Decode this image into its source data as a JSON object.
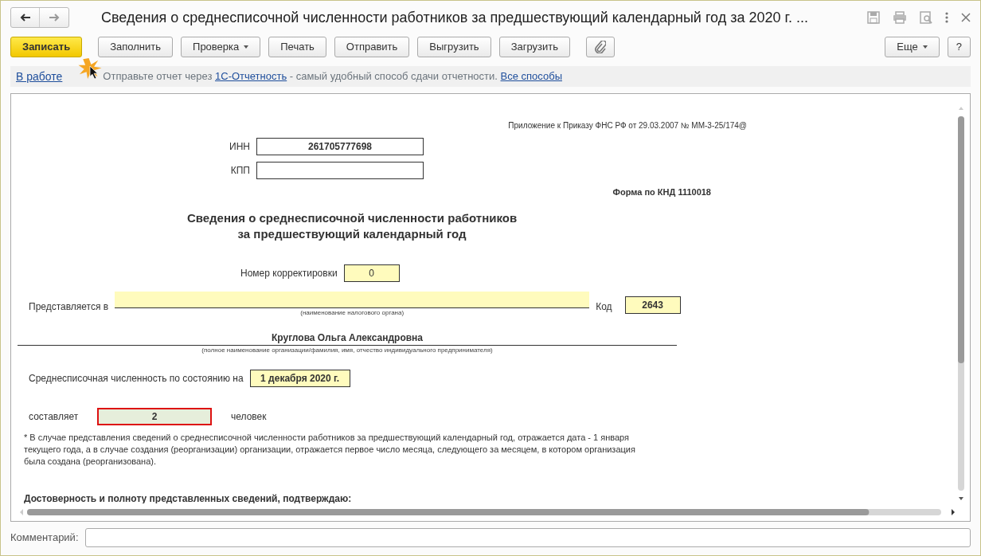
{
  "window": {
    "title": "Сведения о среднесписочной численности работников за предшествующий календарный год за 2020 г. ..."
  },
  "toolbar": {
    "buttons": [
      {
        "kind": "primary",
        "label": "Записать"
      },
      {
        "kind": "plain",
        "label": "Заполнить"
      },
      {
        "kind": "dropdown",
        "label": "Проверка"
      },
      {
        "kind": "plain",
        "label": "Печать"
      },
      {
        "kind": "plain",
        "label": "Отправить"
      },
      {
        "kind": "plain",
        "label": "Выгрузить"
      },
      {
        "kind": "plain",
        "label": "Загрузить"
      },
      {
        "kind": "attach"
      }
    ],
    "right_buttons": [
      {
        "kind": "dropdown",
        "label": "Еще"
      },
      {
        "kind": "plain",
        "label": "?"
      }
    ]
  },
  "info_bar": {
    "status_link": "В работе",
    "before": "Отправьте отчет через",
    "link": "1С-Отчетность",
    "after": "- самый удобный способ сдачи отчетности.",
    "link2": "Все способы"
  },
  "form": {
    "appendix": "Приложение к Приказу ФНС РФ от 29.03.2007 № ММ-3-25/174@",
    "inn": {
      "label": "ИНН",
      "value": "261705777698"
    },
    "kpp": {
      "label": "КПП"
    },
    "knd": "Форма по КНД 1110018",
    "heading": [
      "Сведения о среднесписочной численности работников",
      "за предшествующий календарный год"
    ],
    "correction": {
      "label": "Номер корректировки",
      "value": "0"
    },
    "submitted_to": {
      "label": "Представляется в",
      "caption": "(наименование налогового органа)"
    },
    "code": {
      "label": "Код",
      "value": "2643"
    },
    "organization": {
      "value": "Круглова Ольга Александровна",
      "caption": "(полное наименование организации/фамилия, имя, отчество индивидуального предпринимателя)"
    },
    "headcount_date": {
      "label": "Среднесписочная численность по состоянию на",
      "value": "1 декабря 2020 г."
    },
    "headcount": {
      "label": "составляет",
      "value": "2",
      "unit": "человек",
      "computed": true,
      "highlighted": true
    },
    "footnote": "* В случае представления сведений о среднесписочной численности работников за предшествующий календарный год, отражается дата - 1 января текущего года, а в случае создания (реорганизации) организации, отражается первое число месяца, следующего за месяцем, в котором организация была создана (реорганизована).",
    "confirmation": "Достоверность и полноту представленных сведений, подтверждаю:"
  },
  "comment": {
    "label": "Комментарий:"
  }
}
